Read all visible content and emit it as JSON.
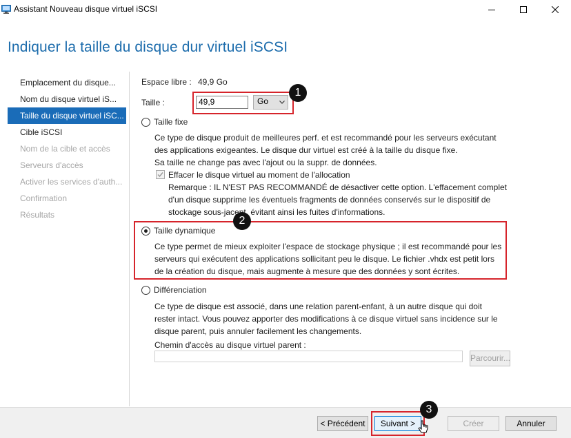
{
  "window": {
    "title": "Assistant Nouveau disque virtuel iSCSI"
  },
  "page": {
    "heading": "Indiquer la taille du disque dur virtuel iSCSI"
  },
  "nav": {
    "items": [
      {
        "label": "Emplacement du disque...",
        "state": "normal"
      },
      {
        "label": "Nom du disque virtuel iS...",
        "state": "normal"
      },
      {
        "label": "Taille du disque virtuel iSC...",
        "state": "selected"
      },
      {
        "label": "Cible iSCSI",
        "state": "normal"
      },
      {
        "label": "Nom de la cible et accès",
        "state": "disabled"
      },
      {
        "label": "Serveurs d'accès",
        "state": "disabled"
      },
      {
        "label": "Activer les services d'auth...",
        "state": "disabled"
      },
      {
        "label": "Confirmation",
        "state": "disabled"
      },
      {
        "label": "Résultats",
        "state": "disabled"
      }
    ]
  },
  "size": {
    "free_label": "Espace libre :",
    "free_value": "49,9 Go",
    "size_label": "Taille :",
    "size_value": "49,9",
    "unit_value": "Go"
  },
  "fixed": {
    "label": "Taille fixe",
    "desc_lines": [
      "Ce type de disque produit de meilleures perf. et est recommandé pour les serveurs exécutant",
      "des applications exigeantes. Le disque dur virtuel est créé à la taille du disque fixe.",
      "Sa taille ne change pas avec l'ajout ou la suppr. de données."
    ],
    "checkbox_label": "Effacer le disque virtuel au moment de l'allocation",
    "remark_lines": [
      "Remarque : IL N'EST PAS RECOMMANDÉ de désactiver cette option. L'effacement complet",
      "d'un disque supprime les éventuels fragments de données conservés sur le dispositif de",
      "stockage sous-jacent, évitant ainsi les fuites d'informations."
    ]
  },
  "dynamic": {
    "label": "Taille dynamique",
    "desc_lines": [
      "Ce type permet de mieux exploiter l'espace de stockage physique ; il est recommandé pour les",
      "serveurs qui exécutent des applications sollicitant peu le disque. Le fichier .vhdx est petit lors",
      "de la création du disque, mais augmente à mesure que des données y sont écrites."
    ]
  },
  "diff": {
    "label": "Différenciation",
    "desc_lines": [
      "Ce type de disque est associé, dans une relation parent-enfant, à un autre disque qui doit",
      "rester intact. Vous pouvez apporter des modifications à ce disque virtuel sans incidence sur le",
      "disque parent, puis annuler facilement les changements."
    ],
    "parent_path_label": "Chemin d'accès au disque virtuel parent :",
    "parent_path_value": "",
    "browse_label": "Parcourir..."
  },
  "annotations": {
    "badge1": "1",
    "badge2": "2",
    "badge3": "3"
  },
  "footer": {
    "prev_label": "< Précédent",
    "next_label": "Suivant >",
    "create_label": "Créer",
    "cancel_label": "Annuler"
  },
  "colors": {
    "heading": "#1c6cac",
    "selected_nav": "#1a6cb8",
    "annotation_red": "#d6242b"
  },
  "icons": [
    "app-icon",
    "minimize-icon",
    "maximize-icon",
    "close-icon",
    "dropdown-arrow-icon",
    "checkmark-icon",
    "mouse-cursor-icon"
  ]
}
